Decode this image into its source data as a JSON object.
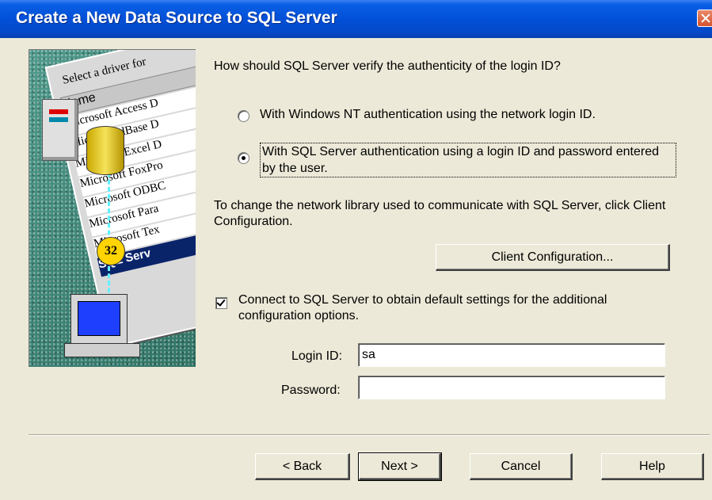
{
  "window": {
    "title": "Create a New Data Source to SQL Server"
  },
  "illustration": {
    "caption": "Select a driver for",
    "column_header": "Name",
    "drivers": [
      "Microsoft Access D",
      "Microsoft dBase D",
      "Microsoft Excel D",
      "Microsoft FoxPro",
      "Microsoft ODBC",
      "Microsoft Para",
      "Microsoft Tex",
      "SQL Serv"
    ],
    "badge": "32"
  },
  "auth": {
    "question": "How should SQL Server verify the authenticity of the login ID?",
    "options": [
      {
        "label": "With Windows NT authentication using the network login ID.",
        "selected": false
      },
      {
        "label": "With SQL Server authentication using a login ID and password entered by the user.",
        "selected": true
      }
    ]
  },
  "network": {
    "info": "To change the network library used to communicate with SQL Server, click Client Configuration.",
    "client_config_label": "Client Configuration..."
  },
  "connect": {
    "label": "Connect to SQL Server to obtain default settings for the additional configuration options.",
    "checked": true
  },
  "fields": {
    "login_label": "Login ID:",
    "login_value": "sa",
    "password_label": "Password:",
    "password_value": ""
  },
  "buttons": {
    "back": "< Back",
    "next": "Next >",
    "cancel": "Cancel",
    "help": "Help"
  },
  "colors": {
    "titlebar": "#0250d8",
    "dialog": "#ece9d8",
    "selection": "#0a246a",
    "close": "#d6532f"
  }
}
